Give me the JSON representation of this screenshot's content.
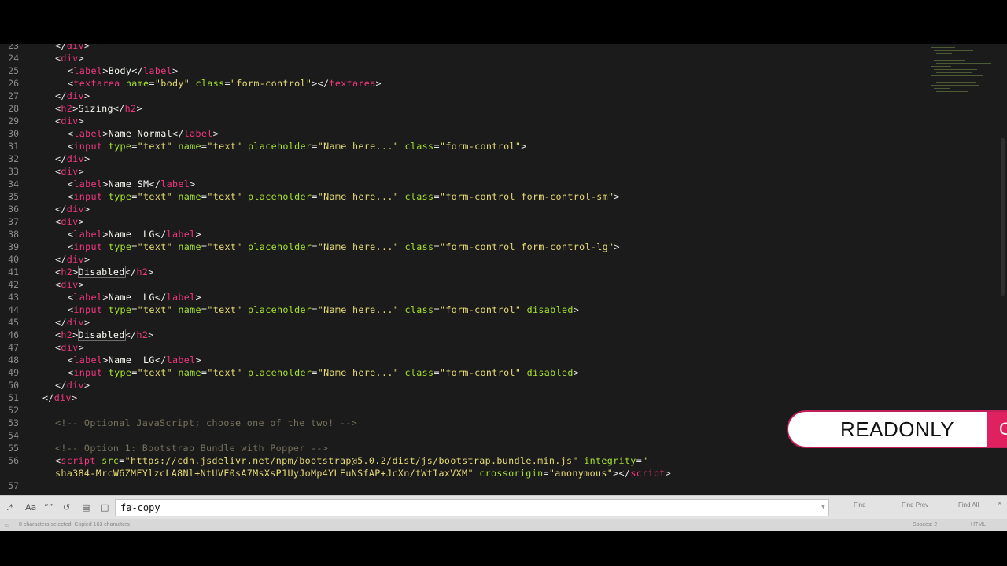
{
  "editor": {
    "lines": [
      {
        "n": "23",
        "indent": 2,
        "t": [
          [
            "tg",
            "</"
          ],
          [
            "tn",
            "div"
          ],
          [
            "tg",
            ">"
          ]
        ]
      },
      {
        "n": "24",
        "indent": 2,
        "t": [
          [
            "tg",
            "<"
          ],
          [
            "tn",
            "div"
          ],
          [
            "tg",
            ">"
          ]
        ]
      },
      {
        "n": "25",
        "indent": 4,
        "t": [
          [
            "tg",
            "<"
          ],
          [
            "tn",
            "label"
          ],
          [
            "tg",
            ">"
          ],
          [
            "tx",
            "Body"
          ],
          [
            "tg",
            "</"
          ],
          [
            "tn",
            "label"
          ],
          [
            "tg",
            ">"
          ]
        ]
      },
      {
        "n": "26",
        "indent": 4,
        "t": [
          [
            "tg",
            "<"
          ],
          [
            "tn",
            "textarea"
          ],
          [
            "tg",
            " "
          ],
          [
            "at",
            "name"
          ],
          [
            "tg",
            "="
          ],
          [
            "sv",
            "\"body\""
          ],
          [
            "tg",
            " "
          ],
          [
            "at",
            "class"
          ],
          [
            "tg",
            "="
          ],
          [
            "sv",
            "\"form-control\""
          ],
          [
            "tg",
            "></"
          ],
          [
            "tn",
            "textarea"
          ],
          [
            "tg",
            ">"
          ]
        ]
      },
      {
        "n": "27",
        "indent": 2,
        "t": [
          [
            "tg",
            "</"
          ],
          [
            "tn",
            "div"
          ],
          [
            "tg",
            ">"
          ]
        ]
      },
      {
        "n": "28",
        "indent": 2,
        "t": [
          [
            "tg",
            "<"
          ],
          [
            "tn",
            "h2"
          ],
          [
            "tg",
            ">"
          ],
          [
            "tx",
            "Sizing"
          ],
          [
            "tg",
            "</"
          ],
          [
            "tn",
            "h2"
          ],
          [
            "tg",
            ">"
          ]
        ]
      },
      {
        "n": "29",
        "indent": 2,
        "t": [
          [
            "tg",
            "<"
          ],
          [
            "tn",
            "div"
          ],
          [
            "tg",
            ">"
          ]
        ]
      },
      {
        "n": "30",
        "indent": 4,
        "t": [
          [
            "tg",
            "<"
          ],
          [
            "tn",
            "label"
          ],
          [
            "tg",
            ">"
          ],
          [
            "tx",
            "Name Normal"
          ],
          [
            "tg",
            "</"
          ],
          [
            "tn",
            "label"
          ],
          [
            "tg",
            ">"
          ]
        ]
      },
      {
        "n": "31",
        "indent": 4,
        "t": [
          [
            "tg",
            "<"
          ],
          [
            "tn",
            "input"
          ],
          [
            "tg",
            " "
          ],
          [
            "at",
            "type"
          ],
          [
            "tg",
            "="
          ],
          [
            "sv",
            "\"text\""
          ],
          [
            "tg",
            " "
          ],
          [
            "at",
            "name"
          ],
          [
            "tg",
            "="
          ],
          [
            "sv",
            "\"text\""
          ],
          [
            "tg",
            " "
          ],
          [
            "at",
            "placeholder"
          ],
          [
            "tg",
            "="
          ],
          [
            "sv",
            "\"Name here...\""
          ],
          [
            "tg",
            " "
          ],
          [
            "at",
            "class"
          ],
          [
            "tg",
            "="
          ],
          [
            "sv",
            "\"form-control\""
          ],
          [
            "tg",
            ">"
          ]
        ]
      },
      {
        "n": "32",
        "indent": 2,
        "t": [
          [
            "tg",
            "</"
          ],
          [
            "tn",
            "div"
          ],
          [
            "tg",
            ">"
          ]
        ]
      },
      {
        "n": "33",
        "indent": 2,
        "t": [
          [
            "tg",
            "<"
          ],
          [
            "tn",
            "div"
          ],
          [
            "tg",
            ">"
          ]
        ]
      },
      {
        "n": "34",
        "indent": 4,
        "t": [
          [
            "tg",
            "<"
          ],
          [
            "tn",
            "label"
          ],
          [
            "tg",
            ">"
          ],
          [
            "tx",
            "Name SM"
          ],
          [
            "tg",
            "</"
          ],
          [
            "tn",
            "label"
          ],
          [
            "tg",
            ">"
          ]
        ]
      },
      {
        "n": "35",
        "indent": 4,
        "t": [
          [
            "tg",
            "<"
          ],
          [
            "tn",
            "input"
          ],
          [
            "tg",
            " "
          ],
          [
            "at",
            "type"
          ],
          [
            "tg",
            "="
          ],
          [
            "sv",
            "\"text\""
          ],
          [
            "tg",
            " "
          ],
          [
            "at",
            "name"
          ],
          [
            "tg",
            "="
          ],
          [
            "sv",
            "\"text\""
          ],
          [
            "tg",
            " "
          ],
          [
            "at",
            "placeholder"
          ],
          [
            "tg",
            "="
          ],
          [
            "sv",
            "\"Name here...\""
          ],
          [
            "tg",
            " "
          ],
          [
            "at",
            "class"
          ],
          [
            "tg",
            "="
          ],
          [
            "sv",
            "\"form-control form-control-sm\""
          ],
          [
            "tg",
            ">"
          ]
        ]
      },
      {
        "n": "36",
        "indent": 2,
        "t": [
          [
            "tg",
            "</"
          ],
          [
            "tn",
            "div"
          ],
          [
            "tg",
            ">"
          ]
        ]
      },
      {
        "n": "37",
        "indent": 2,
        "t": [
          [
            "tg",
            "<"
          ],
          [
            "tn",
            "div"
          ],
          [
            "tg",
            ">"
          ]
        ]
      },
      {
        "n": "38",
        "indent": 4,
        "t": [
          [
            "tg",
            "<"
          ],
          [
            "tn",
            "label"
          ],
          [
            "tg",
            ">"
          ],
          [
            "tx",
            "Name  LG"
          ],
          [
            "tg",
            "</"
          ],
          [
            "tn",
            "label"
          ],
          [
            "tg",
            ">"
          ]
        ]
      },
      {
        "n": "39",
        "indent": 4,
        "t": [
          [
            "tg",
            "<"
          ],
          [
            "tn",
            "input"
          ],
          [
            "tg",
            " "
          ],
          [
            "at",
            "type"
          ],
          [
            "tg",
            "="
          ],
          [
            "sv",
            "\"text\""
          ],
          [
            "tg",
            " "
          ],
          [
            "at",
            "name"
          ],
          [
            "tg",
            "="
          ],
          [
            "sv",
            "\"text\""
          ],
          [
            "tg",
            " "
          ],
          [
            "at",
            "placeholder"
          ],
          [
            "tg",
            "="
          ],
          [
            "sv",
            "\"Name here...\""
          ],
          [
            "tg",
            " "
          ],
          [
            "at",
            "class"
          ],
          [
            "tg",
            "="
          ],
          [
            "sv",
            "\"form-control form-control-lg\""
          ],
          [
            "tg",
            ">"
          ]
        ]
      },
      {
        "n": "40",
        "indent": 2,
        "t": [
          [
            "tg",
            "</"
          ],
          [
            "tn",
            "div"
          ],
          [
            "tg",
            ">"
          ]
        ]
      },
      {
        "n": "41",
        "indent": 2,
        "t": [
          [
            "tg",
            "<"
          ],
          [
            "tn",
            "h2"
          ],
          [
            "tg",
            ">"
          ],
          [
            "hl",
            "Disabled"
          ],
          [
            "tg",
            "</"
          ],
          [
            "tn",
            "h2"
          ],
          [
            "tg",
            ">"
          ]
        ]
      },
      {
        "n": "42",
        "indent": 2,
        "t": [
          [
            "tg",
            "<"
          ],
          [
            "tn",
            "div"
          ],
          [
            "tg",
            ">"
          ]
        ]
      },
      {
        "n": "43",
        "indent": 4,
        "t": [
          [
            "tg",
            "<"
          ],
          [
            "tn",
            "label"
          ],
          [
            "tg",
            ">"
          ],
          [
            "tx",
            "Name  LG"
          ],
          [
            "tg",
            "</"
          ],
          [
            "tn",
            "label"
          ],
          [
            "tg",
            ">"
          ]
        ]
      },
      {
        "n": "44",
        "indent": 4,
        "t": [
          [
            "tg",
            "<"
          ],
          [
            "tn",
            "input"
          ],
          [
            "tg",
            " "
          ],
          [
            "at",
            "type"
          ],
          [
            "tg",
            "="
          ],
          [
            "sv",
            "\"text\""
          ],
          [
            "tg",
            " "
          ],
          [
            "at",
            "name"
          ],
          [
            "tg",
            "="
          ],
          [
            "sv",
            "\"text\""
          ],
          [
            "tg",
            " "
          ],
          [
            "at",
            "placeholder"
          ],
          [
            "tg",
            "="
          ],
          [
            "sv",
            "\"Name here...\""
          ],
          [
            "tg",
            " "
          ],
          [
            "at",
            "class"
          ],
          [
            "tg",
            "="
          ],
          [
            "sv",
            "\"form-control\""
          ],
          [
            "tg",
            " "
          ],
          [
            "at",
            "disabled"
          ],
          [
            "tg",
            ">"
          ]
        ]
      },
      {
        "n": "45",
        "indent": 2,
        "t": [
          [
            "tg",
            "</"
          ],
          [
            "tn",
            "div"
          ],
          [
            "tg",
            ">"
          ]
        ]
      },
      {
        "n": "46",
        "indent": 2,
        "t": [
          [
            "tg",
            "<"
          ],
          [
            "tn",
            "h2"
          ],
          [
            "tg",
            ">"
          ],
          [
            "hl",
            "Disabled"
          ],
          [
            "tg",
            "</"
          ],
          [
            "tn",
            "h2"
          ],
          [
            "tg",
            ">"
          ]
        ]
      },
      {
        "n": "47",
        "indent": 2,
        "t": [
          [
            "tg",
            "<"
          ],
          [
            "tn",
            "div"
          ],
          [
            "tg",
            ">"
          ]
        ]
      },
      {
        "n": "48",
        "indent": 4,
        "t": [
          [
            "tg",
            "<"
          ],
          [
            "tn",
            "label"
          ],
          [
            "tg",
            ">"
          ],
          [
            "tx",
            "Name  LG"
          ],
          [
            "tg",
            "</"
          ],
          [
            "tn",
            "label"
          ],
          [
            "tg",
            ">"
          ]
        ]
      },
      {
        "n": "49",
        "indent": 4,
        "t": [
          [
            "tg",
            "<"
          ],
          [
            "tn",
            "input"
          ],
          [
            "tg",
            " "
          ],
          [
            "at",
            "type"
          ],
          [
            "tg",
            "="
          ],
          [
            "sv",
            "\"text\""
          ],
          [
            "tg",
            " "
          ],
          [
            "at",
            "name"
          ],
          [
            "tg",
            "="
          ],
          [
            "sv",
            "\"text\""
          ],
          [
            "tg",
            " "
          ],
          [
            "at",
            "placeholder"
          ],
          [
            "tg",
            "="
          ],
          [
            "sv",
            "\"Name here...\""
          ],
          [
            "tg",
            " "
          ],
          [
            "at",
            "class"
          ],
          [
            "tg",
            "="
          ],
          [
            "sv",
            "\"form-control\""
          ],
          [
            "tg",
            " "
          ],
          [
            "at",
            "disabled"
          ],
          [
            "tg",
            ">"
          ]
        ]
      },
      {
        "n": "50",
        "indent": 2,
        "t": [
          [
            "tg",
            "</"
          ],
          [
            "tn",
            "div"
          ],
          [
            "tg",
            ">"
          ]
        ]
      },
      {
        "n": "51",
        "indent": 0,
        "t": [
          [
            "tg",
            "</"
          ],
          [
            "tn",
            "div"
          ],
          [
            "tg",
            ">"
          ]
        ]
      },
      {
        "n": "52",
        "indent": 0,
        "t": []
      },
      {
        "n": "53",
        "indent": 2,
        "t": [
          [
            "cm",
            "<!-- Optional JavaScript; choose one of the two! -->"
          ]
        ]
      },
      {
        "n": "54",
        "indent": 0,
        "t": []
      },
      {
        "n": "55",
        "indent": 2,
        "t": [
          [
            "cm",
            "<!-- Option 1: Bootstrap Bundle with Popper -->"
          ]
        ]
      },
      {
        "n": "56",
        "indent": 2,
        "t": [
          [
            "tg",
            "<"
          ],
          [
            "tn",
            "script"
          ],
          [
            "tg",
            " "
          ],
          [
            "at",
            "src"
          ],
          [
            "tg",
            "="
          ],
          [
            "sv",
            "\"https://cdn.jsdelivr.net/npm/bootstrap@5.0.2/dist/js/bootstrap.bundle.min.js\""
          ],
          [
            "tg",
            " "
          ],
          [
            "at",
            "integrity"
          ],
          [
            "tg",
            "="
          ],
          [
            "sv",
            "\""
          ]
        ]
      },
      {
        "n": "",
        "indent": 2,
        "t": [
          [
            "sv",
            "sha384-MrcW6ZMFYlzcLA8Nl+NtUVF0sA7MsXsP1UyJoMp4YLEuNSfAP+JcXn/tWtIaxVXM\""
          ],
          [
            "tg",
            " "
          ],
          [
            "at",
            "crossorigin"
          ],
          [
            "tg",
            "="
          ],
          [
            "sv",
            "\"anonymous\""
          ],
          [
            "tg",
            "></"
          ],
          [
            "tn",
            "script"
          ],
          [
            "tg",
            ">"
          ]
        ]
      },
      {
        "n": "57",
        "indent": 0,
        "t": []
      }
    ]
  },
  "overlay": {
    "readonly_label": "READONLY",
    "tab_glyph": "C"
  },
  "find_bar": {
    "query": "fa-copy",
    "buttons": [
      "Find",
      "Find Prev",
      "Find All"
    ]
  },
  "status_bar": {
    "left_text": "8 characters selected, Copied 163 characters",
    "spaces": "Spaces: 2",
    "syntax": "HTML"
  },
  "colors": {
    "background": "#1b1b1b",
    "tag": "#f2377f",
    "attribute": "#a7e22e",
    "string": "#e6db74",
    "comment": "#75715e",
    "banner_accent": "#e0215f"
  }
}
